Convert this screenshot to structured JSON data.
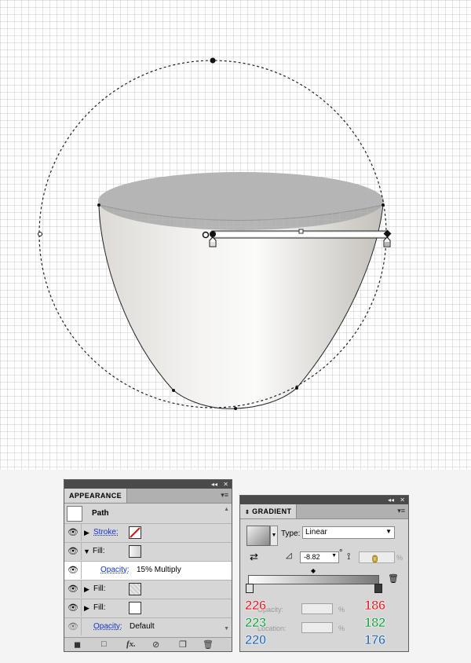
{
  "appearance": {
    "tab": "APPEARANCE",
    "title": "Path",
    "rows": {
      "stroke": "Stroke:",
      "fill1": "Fill:",
      "opacity_label": "Opacity:",
      "opacity_value": "15% Multiply",
      "fill2": "Fill:",
      "fill3": "Fill:",
      "bottom_opacity_label": "Opacity:",
      "bottom_opacity_value": "Default"
    },
    "fx": "fx."
  },
  "gradient": {
    "tab": "GRADIENT",
    "type_label": "Type:",
    "type_value": "Linear",
    "angle": "-8.82",
    "degree": "°",
    "aspect_value": "0",
    "percent": "%",
    "opacity_label": "Opacity:",
    "location_label": "Location:",
    "left_stop": {
      "r": "226",
      "g": "223",
      "b": "220"
    },
    "right_stop": {
      "r": "186",
      "g": "182",
      "b": "176"
    }
  },
  "colors": {
    "left_stop": "#e2dfdc",
    "right_stop": "#bab6b0",
    "ellipse": "#a8a8a8"
  },
  "icons": [
    "eye-icon",
    "close-icon",
    "collapse-icon",
    "panel-menu-icon",
    "new-art-icon",
    "clear-icon",
    "fx-icon",
    "duplicate-icon",
    "trash-icon",
    "reverse-gradient-icon",
    "angle-icon",
    "aspect-ratio-icon",
    "gradient-stop-icon"
  ]
}
